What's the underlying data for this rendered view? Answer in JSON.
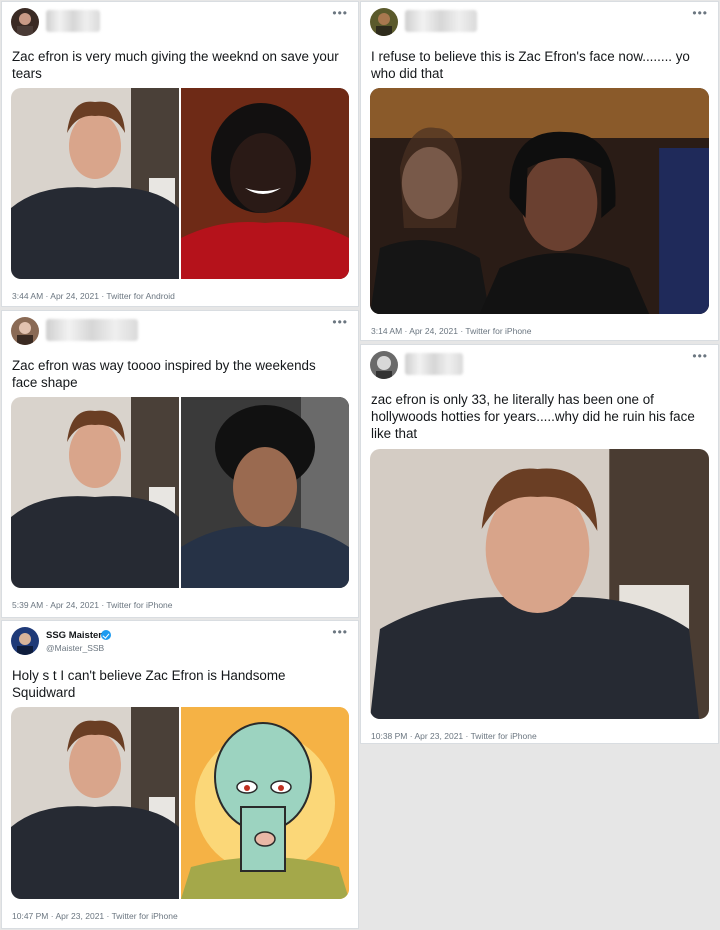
{
  "tweets": [
    {
      "text": "Zac efron is very much giving the weeknd on save your tears",
      "time": "3:44 AM · Apr 24, 2021",
      "source": "Twitter for Android"
    },
    {
      "text": "I refuse to believe this is Zac Efron's face now........ yo who did that",
      "time": "3:14 AM · Apr 24, 2021",
      "source": "Twitter for iPhone"
    },
    {
      "text": "Zac efron was way toooo inspired by the weekends face shape",
      "time": "5:39 AM · Apr 24, 2021",
      "source": "Twitter for iPhone"
    },
    {
      "text": "zac efron is only 33, he literally has been one of hollywoods hotties for years.....why did he ruin his face like that",
      "time": "10:38 PM · Apr 23, 2021",
      "source": "Twitter for iPhone"
    },
    {
      "author_name": "SSG Maister",
      "author_handle": "@Maister_SSB",
      "text": "Holy s t I can't believe Zac Efron is Handsome Squidward",
      "time": "10:47 PM · Apr 23, 2021",
      "source": "Twitter for iPhone"
    }
  ],
  "icons": {
    "more": "more-options-icon",
    "verified": "verified-badge-icon"
  },
  "colors": {
    "background": "#e6e6e6",
    "card": "#ffffff",
    "text": "#14171a",
    "meta": "#6b7680",
    "verified": "#1d9bf0"
  }
}
